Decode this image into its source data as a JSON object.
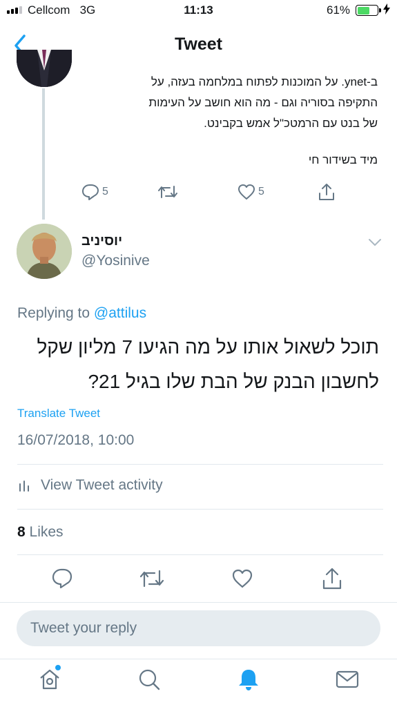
{
  "status_bar": {
    "carrier": "Cellcom",
    "network": "3G",
    "time": "11:13",
    "battery": "61%",
    "battery_level": 0.61
  },
  "nav": {
    "title": "Tweet",
    "back_icon": "chevron-left-icon"
  },
  "parent_tweet": {
    "lines": [
      "ב-ynet. על המוכנות לפתוח במלחמה בעזה, על",
      "התקיפה בסוריה וגם  - מה הוא חושב על העימות",
      "של בנט עם הרמטכ\"ל אמש בקבינט."
    ],
    "live_line": "מיד בשידור חי",
    "reply_count": "5",
    "like_count": "5"
  },
  "tweet": {
    "display_name": "יוסיניב",
    "handle": "@Yosinive",
    "replying_prefix": "Replying to",
    "replying_to": "@attilus",
    "text_lines": [
      "תוכל לשאול אותו על מה הגיעו 7 מליון שקל",
      "לחשבון הבנק של הבת שלו בגיל 21?"
    ],
    "translate_label": "Translate Tweet",
    "timestamp": "16/07/2018, 10:00",
    "activity_label": "View Tweet activity",
    "likes_count": "8",
    "likes_label": "Likes"
  },
  "reply_box": {
    "placeholder": "Tweet your reply"
  },
  "colors": {
    "accent": "#1da1f2",
    "muted": "#657786",
    "battery": "#4cd964"
  }
}
